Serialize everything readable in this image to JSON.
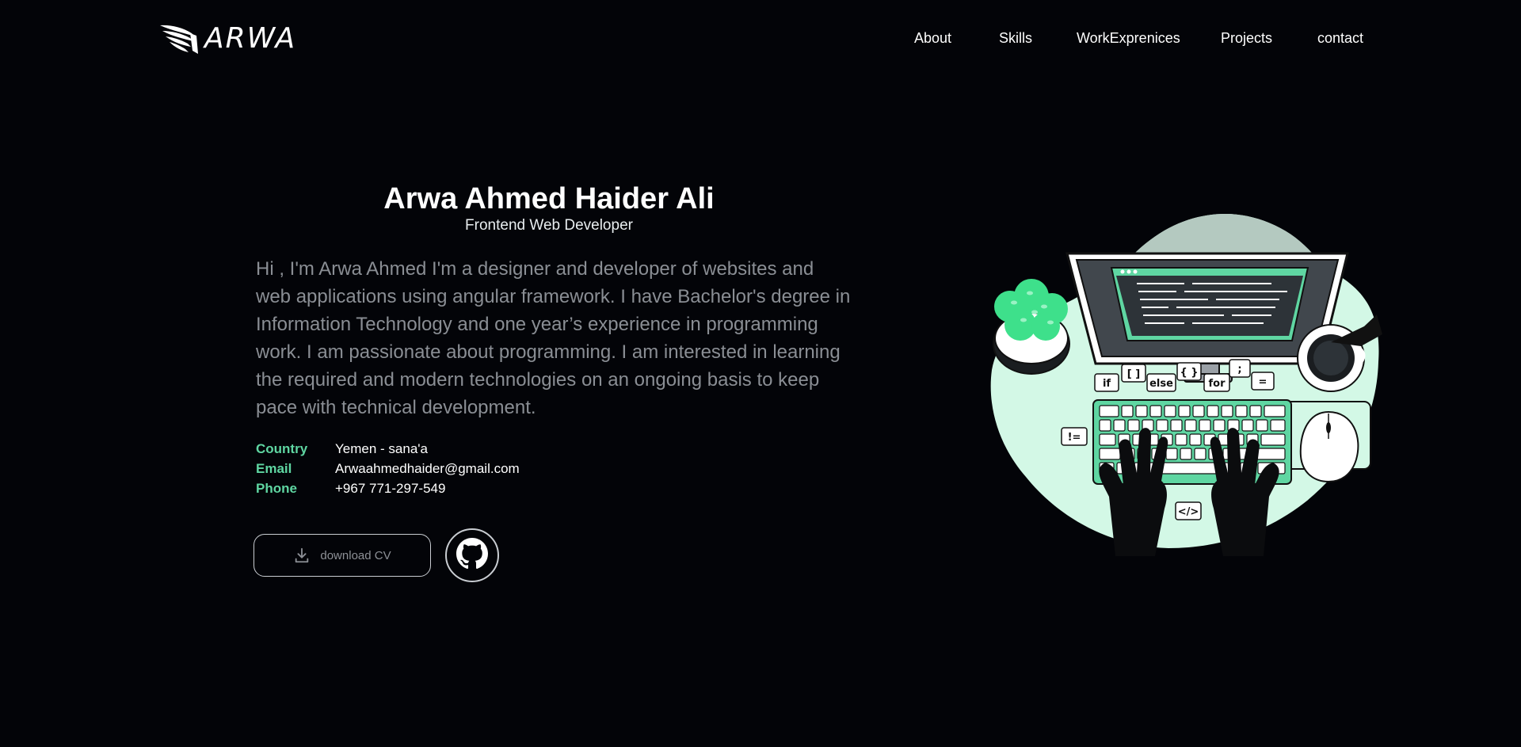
{
  "header": {
    "logo_text": "ARWA",
    "nav": [
      {
        "label": "About"
      },
      {
        "label": "Skills"
      },
      {
        "label": "WorkExprenices"
      },
      {
        "label": "Projects"
      },
      {
        "label": "contact"
      }
    ]
  },
  "hero": {
    "name": "Arwa Ahmed Haider Ali",
    "role": "Frontend Web Developer",
    "bio": "Hi , I'm Arwa Ahmed I'm a designer and developer of websites and web applications using angular framework. I have Bachelor's degree in Information Technology and one year’s experience in programming work. I am passionate about programming. I am interested in learning the required and modern technologies on an ongoing basis to keep pace with technical development.",
    "info": [
      {
        "label": "Country",
        "value": "Yemen - sana'a"
      },
      {
        "label": "Email",
        "value": "Arwaahmedhaider@gmail.com"
      },
      {
        "label": "Phone",
        "value": "+967 771-297-549"
      }
    ],
    "download_label": "download CV"
  },
  "illustration": {
    "code_tags": [
      "if",
      "[ ]",
      "else",
      "{ }",
      "for",
      ";",
      "=",
      "!=",
      "</>"
    ]
  },
  "colors": {
    "background": "#030408",
    "accent": "#5fd6a2",
    "muted_text": "#8a8e94",
    "illustration_mint": "#d3f8e6"
  },
  "icons": {
    "logo": "wing-icon",
    "download": "download-icon",
    "github": "github-icon"
  }
}
